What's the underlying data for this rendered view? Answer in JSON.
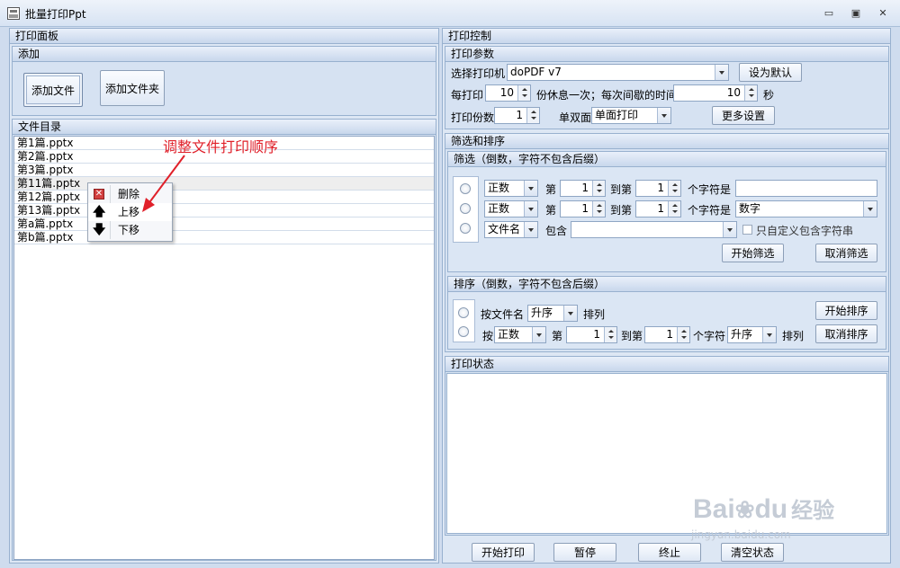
{
  "window": {
    "title": "批量打印Ppt",
    "minimize": "▭",
    "restore": "▣",
    "close": "✕"
  },
  "left": {
    "panel_title": "打印面板",
    "add_section_title": "添加",
    "add_file_label": "添加文件",
    "add_folder_label": "添加文件夹",
    "dir_section_title": "文件目录",
    "files": [
      "第1篇.pptx",
      "第2篇.pptx",
      "第3篇.pptx",
      "第11篇.pptx",
      "第12篇.pptx",
      "第13篇.pptx",
      "第a篇.pptx",
      "第b篇.pptx"
    ],
    "context_menu": {
      "delete": "删除",
      "move_up": "上移",
      "move_down": "下移"
    },
    "annotation": "调整文件打印顺序"
  },
  "right": {
    "panel_title": "打印控制",
    "params": {
      "title": "打印参数",
      "printer_label": "选择打印机",
      "printer_value": "doPDF v7",
      "set_default": "设为默认",
      "every_print_label": "每打印",
      "every_print_value": "10",
      "rest_label": "份休息一次；每次间歇的时间",
      "interval_value": "10",
      "seconds_label": "秒",
      "copies_label": "打印份数",
      "copies_value": "1",
      "duplex_label": "单双面",
      "duplex_value": "单面打印",
      "more_settings": "更多设置"
    },
    "filter_sort": {
      "title": "筛选和排序",
      "filter_title": "筛选（倒数，字符不包含后缀）",
      "row1": {
        "mode": "正数",
        "di": "第",
        "from": "1",
        "to_label": "到第",
        "to": "1",
        "char_label": "个字符是",
        "value": ""
      },
      "row2": {
        "mode": "正数",
        "di": "第",
        "from": "1",
        "to_label": "到第",
        "to": "1",
        "char_label": "个字符是",
        "value": "数字"
      },
      "row3": {
        "mode": "文件名",
        "contains_label": "包含",
        "value": "",
        "custom_label": "只自定义包含字符串"
      },
      "start_filter": "开始筛选",
      "cancel_filter": "取消筛选",
      "sort_title": "排序（倒数，字符不包含后缀）",
      "sort_row1": {
        "by_label": "按文件名",
        "order": "升序",
        "arrange": "排列"
      },
      "sort_row2": {
        "by_label": "按",
        "mode": "正数",
        "di": "第",
        "from": "1",
        "to_label": "到第",
        "to": "1",
        "char_label": "个字符",
        "order": "升序",
        "arrange": "排列"
      },
      "start_sort": "开始排序",
      "cancel_sort": "取消排序"
    },
    "status": {
      "title": "打印状态"
    },
    "bottom": {
      "start_print": "开始打印",
      "pause": "暂停",
      "stop": "终止",
      "clear_status": "清空状态"
    }
  },
  "watermark": {
    "brand_a": "Bai",
    "brand_b": "du",
    "brand_c": "经验",
    "url": "jingyan.baidu.com"
  }
}
